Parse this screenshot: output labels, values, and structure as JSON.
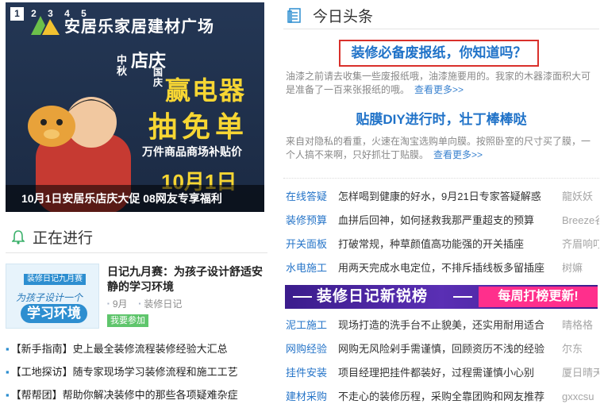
{
  "carousel": {
    "slides": [
      "1",
      "2",
      "3",
      "4",
      "5"
    ],
    "active_slide": 1,
    "brand": "安居乐家居建材广场",
    "promo_small": "中秋",
    "promo_store": "店庆",
    "promo_national": "国庆",
    "promo_win": "赢电器",
    "promo_free": "抽免单",
    "promo_sub": "万件商品商场补贴价",
    "promo_date": "10月1日",
    "caption": "10月1日安居乐店庆大促 08网友专享福利"
  },
  "ongoing": {
    "title": "正在进行",
    "diary": {
      "thumb_banner": "装修日记九月赛",
      "thumb_line1": "为孩子设计一个",
      "thumb_line2": "学习环境",
      "title": "日记九月赛：为孩子设计舒适安静的学习环境",
      "month": "9月",
      "category": "装修日记",
      "join_label": "我要参加"
    },
    "news": [
      "【新手指南】史上最全装修流程装修经验大汇总",
      "【工地探访】随专家现场学习装修流程和施工工艺",
      "【帮帮团】帮助你解决装修中的那些各项疑难杂症"
    ]
  },
  "headlines": {
    "title": "今日头条",
    "h1": "装修必备废报纸，你知道吗？",
    "d1": "油漆之前请去收集一些废报纸哦，油漆施要用的。我家的木器漆面积大可是准备了一百来张报纸的哦。",
    "h2": "贴膜DIY进行时，壮丁棒棒哒",
    "d2": "来自对隐私的看重，火速在淘宝选购单向膜。按照卧室的尺寸买了膜，一个人搞不来啊，只好抓壮丁贴膜。",
    "more": "查看更多>>"
  },
  "qa_top": [
    {
      "cat": "在线答疑",
      "text": "怎样喝到健康的好水，9月21日专家答疑解惑",
      "user": "龍妖妖"
    },
    {
      "cat": "装修预算",
      "text": "血拼后回神，如何拯救我那严重超支的预算",
      "user": "Breeze谷"
    },
    {
      "cat": "开关面板",
      "text": "打破常规，种草颜值高功能强的开关插座",
      "user": "齐眉响叮当"
    },
    {
      "cat": "水电施工",
      "text": "用两天完成水电定位，不排斥插线板多留插座",
      "user": "树嫲"
    }
  ],
  "strip": {
    "left": "装修日记新锐榜",
    "right": "每周打榜更新!"
  },
  "qa_bottom": [
    {
      "cat": "泥工施工",
      "text": "现场打造的洗手台不止貌美，还实用耐用适合",
      "user": "晴格格"
    },
    {
      "cat": "网购经验",
      "text": "网购无风险剁手需谨慎，回顾资历不浅的经验",
      "user": "尔东"
    },
    {
      "cat": "挂件安装",
      "text": "项目经理把挂件都装好，过程需谨慎小心别",
      "user": "厦日晴天"
    },
    {
      "cat": "建材采购",
      "text": "不走心的装修历程，采购全靠团购和网友推荐",
      "user": "gxxcsu"
    }
  ],
  "colors": {
    "link": "#1f72c8",
    "highlight_border": "#d9302b",
    "strip": "#4a26a0",
    "strip_accent": "#ff2f8c",
    "join": "#5fc56c"
  }
}
